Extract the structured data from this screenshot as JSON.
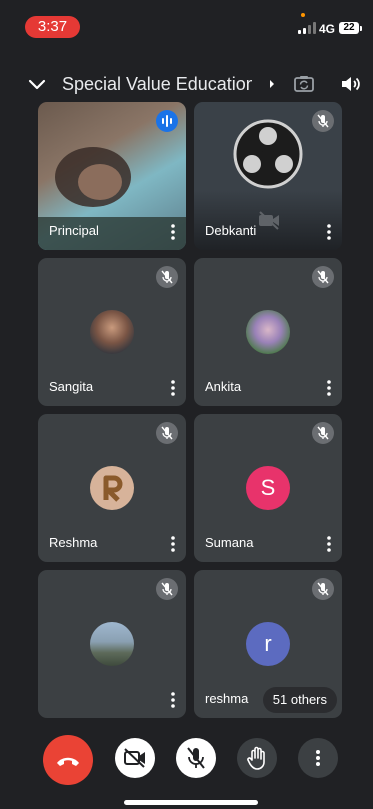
{
  "status_bar": {
    "time": "3:37",
    "network": "4G",
    "battery": "22"
  },
  "header": {
    "meeting_title": "Special Value Education..."
  },
  "tiles": [
    {
      "name": "Principal",
      "speaking": true,
      "video": "camera"
    },
    {
      "name": "Debkanti",
      "muted": true,
      "video": "off"
    },
    {
      "name": "Sangita",
      "muted": true,
      "video": "photo-avatar"
    },
    {
      "name": "Ankita",
      "muted": true,
      "video": "photo-avatar"
    },
    {
      "name": "Reshma",
      "muted": true,
      "video": "photo-avatar"
    },
    {
      "name": "Sumana",
      "muted": true,
      "avatar_letter": "S",
      "avatar_color": "#e8336b"
    },
    {
      "name": "",
      "muted": true,
      "video": "photo-avatar"
    },
    {
      "name": "reshma",
      "muted": true,
      "avatar_letter": "r",
      "avatar_color": "#5c6bc0",
      "others_label": "51 others"
    }
  ],
  "colors": {
    "background": "#202124",
    "tile": "#3c4043",
    "end_call": "#ea4335",
    "speaking": "#1a73e8"
  },
  "controls": {
    "end_call": "end-call-icon",
    "camera": "camera-off-icon",
    "mic": "mic-off-icon",
    "raise_hand": "hand-icon",
    "more": "more-vert-icon"
  }
}
